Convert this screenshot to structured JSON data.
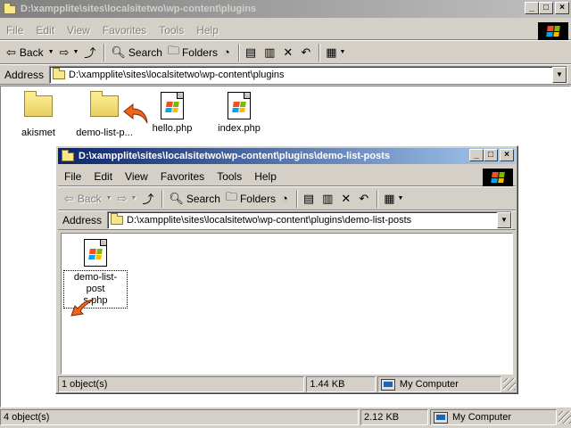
{
  "main": {
    "title": "D:\\xampplite\\sites\\localsitetwo\\wp-content\\plugins",
    "menu": [
      "File",
      "Edit",
      "View",
      "Favorites",
      "Tools",
      "Help"
    ],
    "toolbar": {
      "back": "Back",
      "search": "Search",
      "folders": "Folders"
    },
    "address": {
      "label": "Address",
      "value": "D:\\xampplite\\sites\\localsitetwo\\wp-content\\plugins"
    },
    "items": [
      {
        "type": "folder",
        "label": "akismet"
      },
      {
        "type": "folder",
        "label": "demo-list-p..."
      },
      {
        "type": "php",
        "label": "hello.php"
      },
      {
        "type": "php",
        "label": "index.php"
      }
    ],
    "status": {
      "objects": "4 object(s)",
      "size": "2.12 KB",
      "zone": "My Computer"
    }
  },
  "child": {
    "title": "D:\\xampplite\\sites\\localsitetwo\\wp-content\\plugins\\demo-list-posts",
    "menu": [
      "File",
      "Edit",
      "View",
      "Favorites",
      "Tools",
      "Help"
    ],
    "toolbar": {
      "back": "Back",
      "search": "Search",
      "folders": "Folders"
    },
    "address": {
      "label": "Address",
      "value": "D:\\xampplite\\sites\\localsitetwo\\wp-content\\plugins\\demo-list-posts"
    },
    "items": [
      {
        "type": "php",
        "label_line1": "demo-list-post",
        "label_line2": "s.php"
      }
    ],
    "status": {
      "objects": "1 object(s)",
      "size": "1.44 KB",
      "zone": "My Computer"
    }
  },
  "colors": {
    "active_title": "#0a246a",
    "inactive_title": "#808080",
    "face": "#d4d0c8",
    "cursor_arrow": "#f0641e"
  },
  "icons": [
    "folder-icon",
    "php-file-icon",
    "windows-logo-icon",
    "my-computer-icon",
    "cursor-arrow-icon"
  ]
}
